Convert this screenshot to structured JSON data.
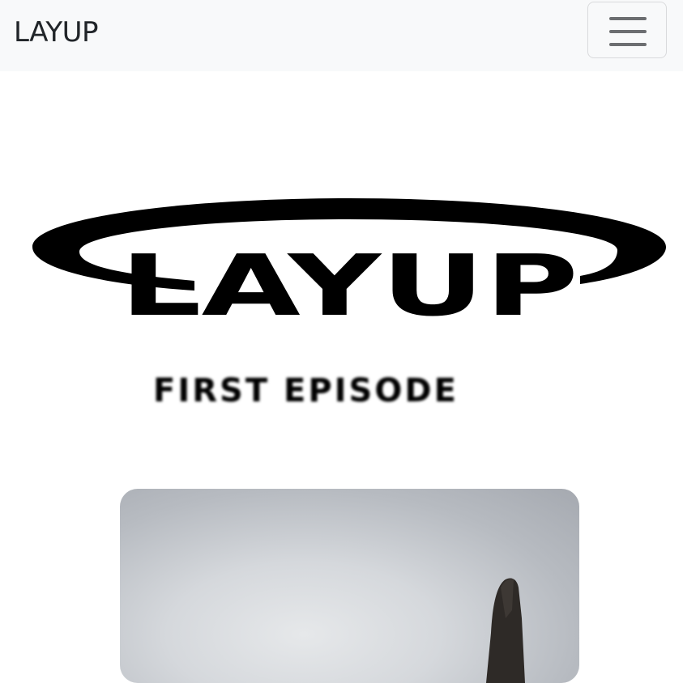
{
  "navbar": {
    "brand": "LAYUP",
    "toggle_icon": "hamburger-menu-icon"
  },
  "logo": {
    "text": "LAYUP",
    "icon": "orbit-ring-logo"
  },
  "subtitle": "FIRST EPISODE",
  "hero_image": {
    "icon": "sculpture-photo"
  },
  "colors": {
    "navbar_bg": "#f8f9fa",
    "text": "#212529",
    "logo": "#000000"
  }
}
